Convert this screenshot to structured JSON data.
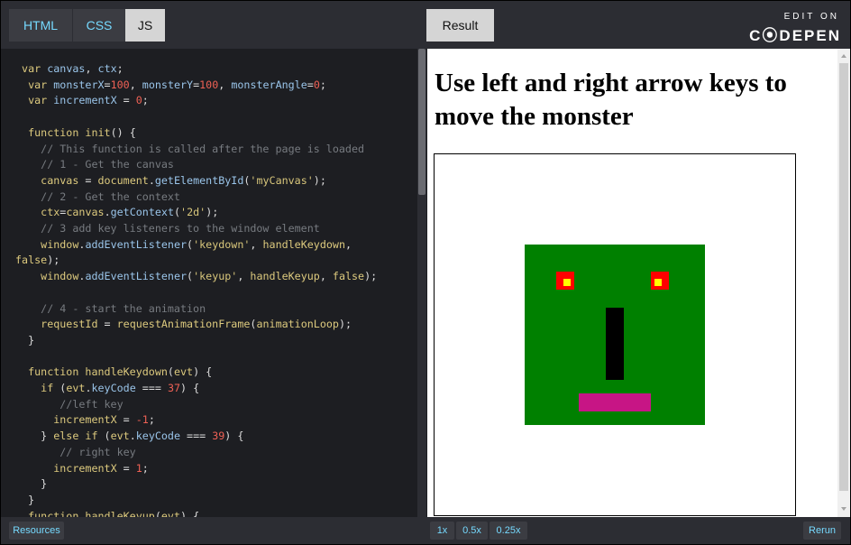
{
  "editor": {
    "tabs": [
      {
        "label": "HTML",
        "active": false
      },
      {
        "label": "CSS",
        "active": false
      },
      {
        "label": "JS",
        "active": true
      }
    ]
  },
  "result": {
    "tab_label": "Result",
    "edit_on": "EDIT ON",
    "brand": "C⦿DEPEN",
    "heading": "Use left and right arrow keys to move the monster"
  },
  "monster": {
    "body_color": "#008000",
    "eye_outer_color": "#ff0000",
    "eye_inner_color": "#ffff00",
    "nose_color": "#000000",
    "mouth_color": "#c71585"
  },
  "bottom": {
    "resources": "Resources",
    "zoom_options": [
      "1x",
      "0.5x",
      "0.25x"
    ],
    "rerun": "Rerun"
  },
  "colors": {
    "editor_bg": "#1d1e22",
    "bar_bg": "#2c2d33",
    "tab_text": "#76daff"
  }
}
